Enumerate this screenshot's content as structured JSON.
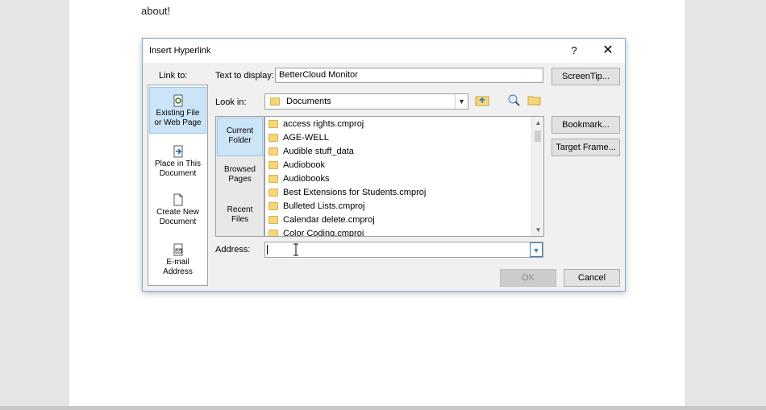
{
  "document": {
    "text": "about!"
  },
  "dialog": {
    "title": "Insert Hyperlink",
    "help_label": "?",
    "close_label": "✕",
    "link_to_label": "Link to:",
    "text_to_display_label": "Text to display:",
    "text_to_display_value": "BetterCloud Monitor",
    "screentip_label": "ScreenTip...",
    "look_in_label": "Look in:",
    "look_in_value": "Documents",
    "bookmark_label": "Bookmark...",
    "target_frame_label": "Target Frame...",
    "address_label": "Address:",
    "address_value": "",
    "ok_label": "OK",
    "cancel_label": "Cancel",
    "link_to": [
      {
        "label_line1": "Existing File",
        "label_line2": "or Web Page",
        "icon": "web-page-icon",
        "selected": true
      },
      {
        "label_line1": "Place in This",
        "label_line2": "Document",
        "icon": "place-in-document-icon",
        "selected": false
      },
      {
        "label_line1": "Create New",
        "label_line2": "Document",
        "icon": "new-document-icon",
        "selected": false
      },
      {
        "label_line1": "E-mail",
        "label_line2": "Address",
        "icon": "email-icon",
        "selected": false
      }
    ],
    "nav": [
      {
        "label_line1": "Current",
        "label_line2": "Folder",
        "selected": true
      },
      {
        "label_line1": "Browsed",
        "label_line2": "Pages",
        "selected": false
      },
      {
        "label_line1": "Recent",
        "label_line2": "Files",
        "selected": false
      }
    ],
    "files": [
      "access rights.cmproj",
      "AGE-WELL",
      "Audible stuff_data",
      "Audiobook",
      "Audiobooks",
      "Best Extensions for Students.cmproj",
      "Bulleted Lists.cmproj",
      "Calendar delete.cmproj",
      "Color Coding.cmproj"
    ]
  }
}
